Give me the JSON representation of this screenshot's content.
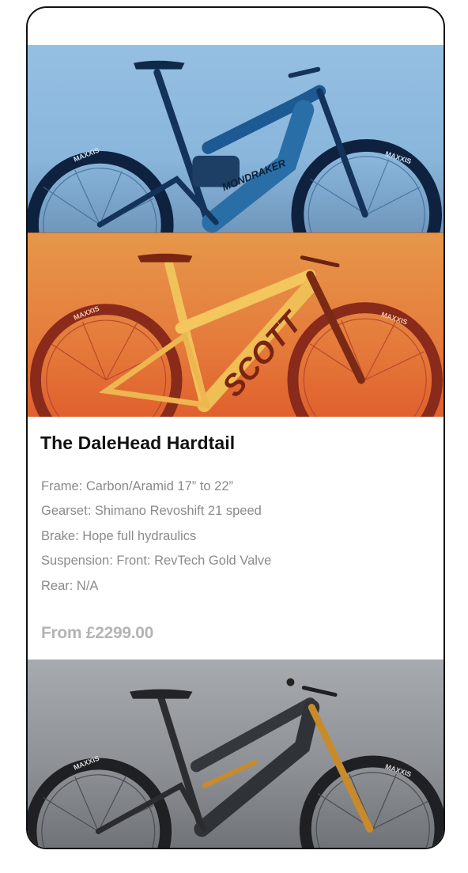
{
  "product": {
    "title": "The DaleHead Hardtail",
    "specs": [
      "Frame: Carbon/Aramid 17” to 22”",
      "Gearset: Shimano Revoshift 21 speed",
      "Brake: Hope full hydraulics",
      "Suspension: Front: RevTech Gold Valve",
      "Rear: N/A"
    ],
    "price": "From £2299.00"
  },
  "images": {
    "bike1": {
      "name": "blue-e-mtb-image",
      "tyre_text": "MAXXIS",
      "frame_text": "MONDRAKER"
    },
    "bike2": {
      "name": "orange-hardtail-image",
      "tyre_text": "MAXXIS",
      "frame_text": "SCOTT"
    },
    "bike3": {
      "name": "grey-full-suspension-image",
      "tyre_text": "MAXXIS"
    }
  },
  "colors": {
    "blue_panel": "#8ab6dc",
    "orange_panel": "#e57b3b",
    "grey_panel": "#8d9196",
    "price_text": "#b4b4b4",
    "spec_text": "#8a8a8a"
  }
}
